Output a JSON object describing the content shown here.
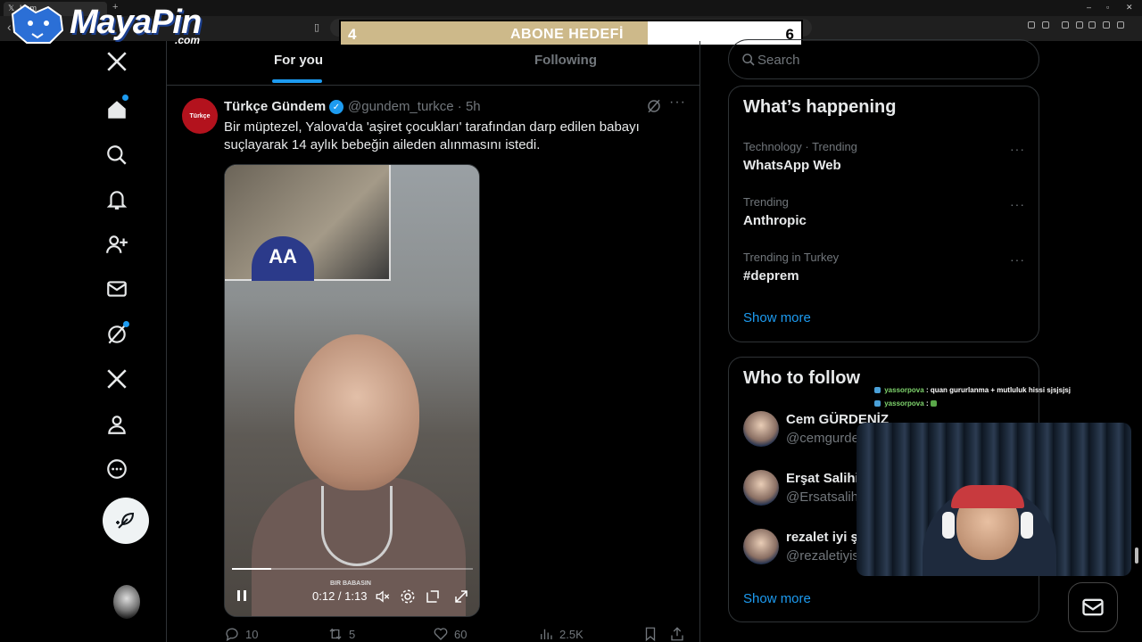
{
  "browser": {
    "tab_title": "Hom",
    "new_tab": "+",
    "window_controls": [
      "–",
      "▫",
      "✕"
    ]
  },
  "overlay": {
    "logo_text": "MayaPin",
    "logo_sub": ".com",
    "goal": {
      "current": "4",
      "label": "ABONE HEDEFİ",
      "target": "6",
      "progress": 0.6667
    }
  },
  "nav": {
    "items": [
      "x-logo",
      "home",
      "explore",
      "notifications",
      "follow",
      "messages",
      "grok",
      "premium",
      "profile",
      "more"
    ],
    "post_button": "post"
  },
  "timeline": {
    "tabs": [
      {
        "label": "For you",
        "active": true
      },
      {
        "label": "Following",
        "active": false
      }
    ]
  },
  "post": {
    "author_name": "Türkçe Gündem",
    "avatar_text": "Türkçe",
    "handle_time": "@gundem_turkce · 5h",
    "more": "···",
    "text": "Bir müptezel, Yalova'da 'aşiret çocukları' tarafından darp edilen babayı suçlayarak 14 aylık bebeğin aileden alınmasını istedi.",
    "video": {
      "inset_logo": "AA",
      "caption": "BIR BABASIN",
      "time": "0:12 / 1:13",
      "progress": 0.164
    },
    "actions": {
      "replies": "10",
      "reposts": "5",
      "likes": "60",
      "views": "2.5K"
    }
  },
  "search": {
    "placeholder": "Search"
  },
  "trends": {
    "title": "What’s happening",
    "items": [
      {
        "meta": "Technology · Trending",
        "name": "WhatsApp Web"
      },
      {
        "meta": "Trending",
        "name": "Anthropic"
      },
      {
        "meta": "Trending in Turkey",
        "name": "#deprem"
      }
    ],
    "show_more": "Show more"
  },
  "who_to_follow": {
    "title": "Who to follow",
    "items": [
      {
        "name": "Cem GÜRDENİZ",
        "handle": "@cemgurde"
      },
      {
        "name": "Erşat Salihi",
        "handle": "@Ersatsalih"
      },
      {
        "name": "rezalet iyi ş",
        "handle": "@rezaletiyis"
      }
    ],
    "show_more": "Show more"
  },
  "chat": [
    {
      "user": "yassorpova",
      "text": ": quan gururlanma + mutluluk hissi sjsjsjsj"
    },
    {
      "user": "yassorpova",
      "text": ":"
    }
  ],
  "colors": {
    "accent": "#1d9bf0",
    "background": "#000000",
    "border": "#2f3336",
    "muted_text": "#71767b",
    "goal_fill": "#cdb98a"
  }
}
